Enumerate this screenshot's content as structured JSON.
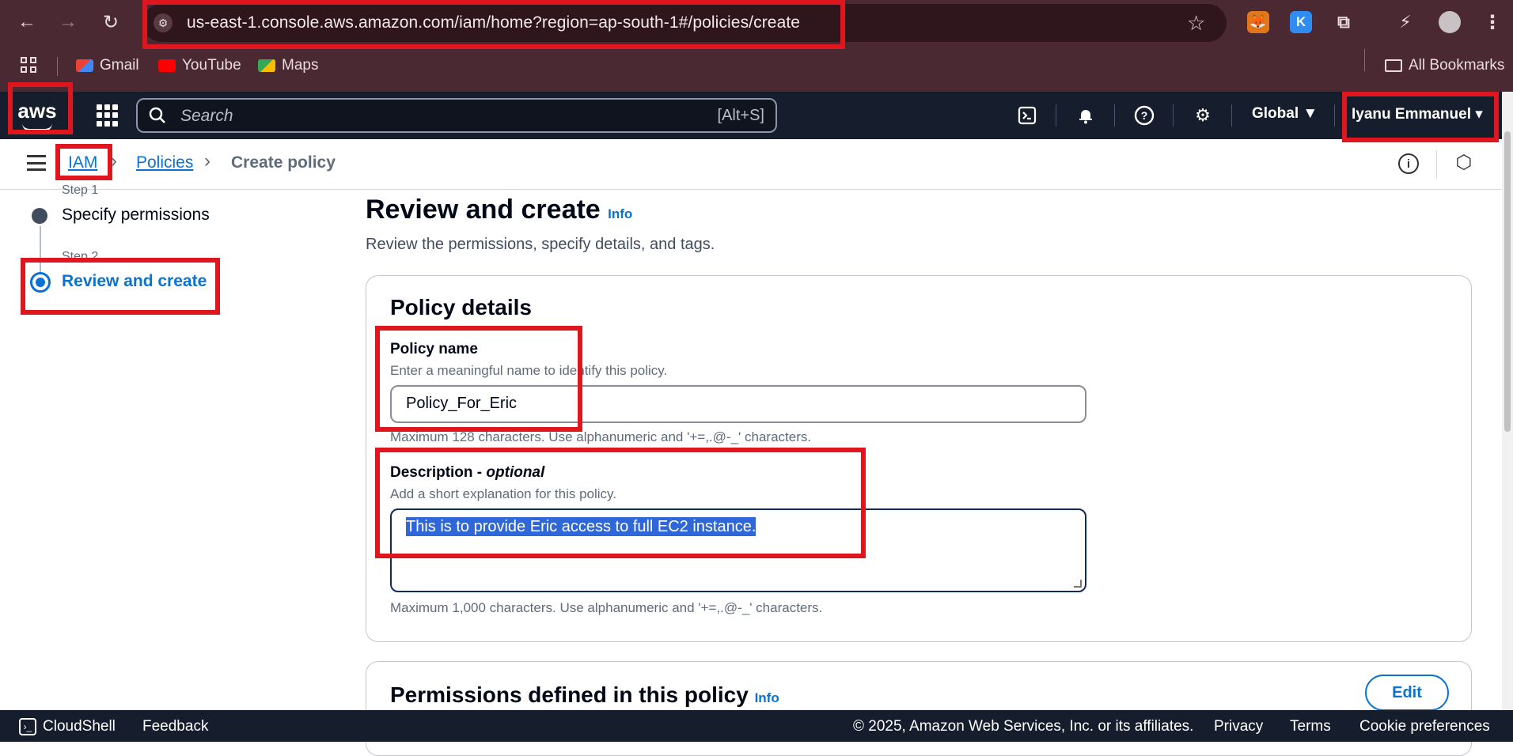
{
  "browser": {
    "url": "us-east-1.console.aws.amazon.com/iam/home?region=ap-south-1#/policies/create",
    "bookmarks": [
      "Gmail",
      "YouTube",
      "Maps"
    ],
    "all_bookmarks": "All Bookmarks",
    "extension_k": "K"
  },
  "aws_header": {
    "logo": "aws",
    "search_placeholder": "Search",
    "search_shortcut": "[Alt+S]",
    "region": "Global ▼",
    "user": "Iyanu Emmanuel"
  },
  "breadcrumb": {
    "items": [
      "IAM",
      "Policies",
      "Create policy"
    ]
  },
  "steps": [
    {
      "label": "Step 1",
      "name": "Specify permissions"
    },
    {
      "label": "Step 2",
      "name": "Review and create"
    }
  ],
  "main": {
    "title": "Review and create",
    "info": "Info",
    "subtitle": "Review the permissions, specify details, and tags.",
    "policy_details": {
      "title": "Policy details",
      "name_label": "Policy name",
      "name_desc": "Enter a meaningful name to identify this policy.",
      "name_value": "Policy_For_Eric",
      "name_hint": "Maximum 128 characters. Use alphanumeric and '+=,.@-_' characters.",
      "desc_label": "Description - ",
      "desc_optional": "optional",
      "desc_desc": "Add a short explanation for this policy.",
      "desc_value": "This is to provide Eric access to full EC2 instance.",
      "desc_hint": "Maximum 1,000 characters. Use alphanumeric and '+=,.@-_' characters."
    },
    "permissions": {
      "title": "Permissions defined in this policy",
      "info": "Info",
      "edit": "Edit"
    }
  },
  "footer": {
    "cloudshell": "CloudShell",
    "feedback": "Feedback",
    "copyright": "© 2025, Amazon Web Services, Inc. or its affiliates.",
    "privacy": "Privacy",
    "terms": "Terms",
    "cookies": "Cookie preferences"
  },
  "colors": {
    "accent": "#0972d3",
    "highlight_box": "#e0161f",
    "aws_bar": "#161e2d"
  }
}
